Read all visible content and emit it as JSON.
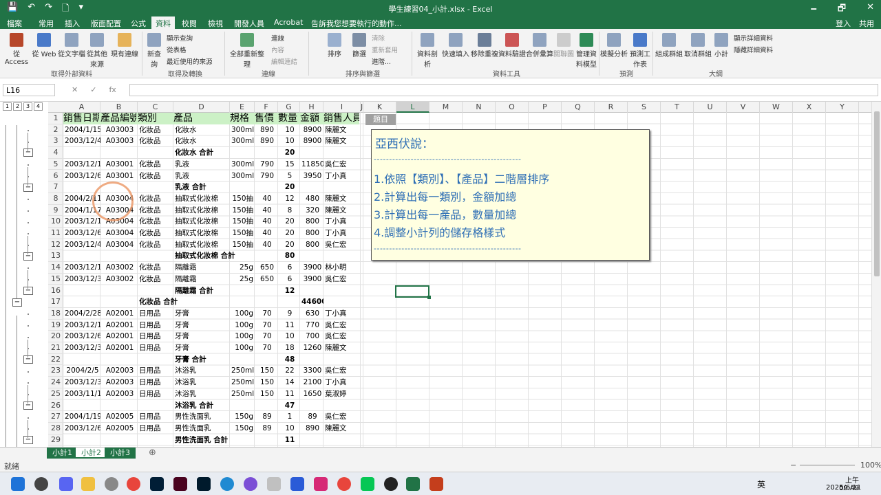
{
  "window": {
    "title": "學生練習04_小計.xlsx - Excel",
    "controls": [
      "🗕",
      "🗗",
      "✕"
    ],
    "quick_access": [
      "💾",
      "↶",
      "↷",
      "🗋",
      "▾"
    ]
  },
  "ribbon_tabs": [
    "檔案",
    "常用",
    "插入",
    "版面配置",
    "公式",
    "資料",
    "校閱",
    "檢視",
    "開發人員",
    "Acrobat",
    "告訴我您想要執行的動作..."
  ],
  "active_tab": "資料",
  "account": {
    "signin": "登入",
    "share": "共用"
  },
  "ribbon": {
    "groups": [
      "取得外部資料",
      "取得及轉換",
      "連線",
      "排序與篩選",
      "資料工具",
      "預測",
      "大綱"
    ],
    "buttons": {
      "access": "從 Access",
      "web": "從 Web",
      "text": "從文字檔",
      "other": "從其他來源",
      "existing": "現有連線",
      "newquery": "新查詢",
      "showquery": "顯示查詢",
      "fromtable": "從表格",
      "recent": "最近使用的來源",
      "refreshall": "全部重新整理",
      "conn": "連線",
      "props": "內容",
      "editlinks": "編輯連結",
      "sort": "排序",
      "filter": "篩選",
      "clear": "清除",
      "reapply": "重新套用",
      "advanced": "進階...",
      "textcol": "資料剖析",
      "flash": "快速填入",
      "dup": "移除重複",
      "valid": "資料驗證",
      "consol": "合併彙算",
      "rel": "關聯圖",
      "model": "管理資料模型",
      "whatif": "模擬分析",
      "forecast": "預測工作表",
      "group": "組成群組",
      "ungroup": "取消群組",
      "subtotal": "小計",
      "showdetail": "顯示詳細資料",
      "hidedetail": "隱藏詳細資料"
    }
  },
  "namebox": "L16",
  "fx": "fx",
  "columns": [
    "A",
    "B",
    "C",
    "D",
    "E",
    "F",
    "G",
    "H",
    "I",
    "J",
    "K",
    "L",
    "M",
    "N",
    "O",
    "P",
    "Q",
    "R",
    "S",
    "T",
    "U",
    "V",
    "W",
    "X",
    "Y"
  ],
  "selected_col": "L",
  "outline_levels": [
    "1",
    "2",
    "3",
    "4"
  ],
  "rows": [
    {
      "n": "1",
      "hdr": true,
      "A": "銷售日期",
      "B": "產品編號",
      "C": "類別",
      "D": "產品",
      "E": "規格",
      "F": "售價",
      "G": "數量",
      "H": "金額",
      "I": "銷售人員"
    },
    {
      "n": "2",
      "A": "2004/1/15",
      "B": "A03003",
      "C": "化妝品",
      "D": "化妝水",
      "E": "300ml",
      "F": "890",
      "G": "10",
      "H": "8900",
      "I": "陳麗文"
    },
    {
      "n": "3",
      "A": "2003/12/4",
      "B": "A03003",
      "C": "化妝品",
      "D": "化妝水",
      "E": "300ml",
      "F": "890",
      "G": "10",
      "H": "8900",
      "I": "陳麗文"
    },
    {
      "n": "4",
      "D": "化妝水 合計",
      "G": "20",
      "sub": true
    },
    {
      "n": "5",
      "A": "2003/12/16",
      "B": "A03001",
      "C": "化妝品",
      "D": "乳液",
      "E": "300ml",
      "F": "790",
      "G": "15",
      "H": "11850",
      "I": "吳仁宏"
    },
    {
      "n": "6",
      "A": "2003/12/6",
      "B": "A03001",
      "C": "化妝品",
      "D": "乳液",
      "E": "300ml",
      "F": "790",
      "G": "5",
      "H": "3950",
      "I": "丁小真"
    },
    {
      "n": "7",
      "D": "乳液 合計",
      "G": "20",
      "sub": true
    },
    {
      "n": "8",
      "A": "2004/2/11",
      "B": "A03004",
      "C": "化妝品",
      "D": "抽取式化妝棉",
      "E": "150抽",
      "F": "40",
      "G": "12",
      "H": "480",
      "I": "陳麗文"
    },
    {
      "n": "9",
      "A": "2004/1/17",
      "B": "A03004",
      "C": "化妝品",
      "D": "抽取式化妝棉",
      "E": "150抽",
      "F": "40",
      "G": "8",
      "H": "320",
      "I": "陳麗文"
    },
    {
      "n": "10",
      "A": "2003/12/10",
      "B": "A03004",
      "C": "化妝品",
      "D": "抽取式化妝棉",
      "E": "150抽",
      "F": "40",
      "G": "20",
      "H": "800",
      "I": "丁小真"
    },
    {
      "n": "11",
      "A": "2003/12/6",
      "B": "A03004",
      "C": "化妝品",
      "D": "抽取式化妝棉",
      "E": "150抽",
      "F": "40",
      "G": "20",
      "H": "800",
      "I": "丁小真"
    },
    {
      "n": "12",
      "A": "2003/12/4",
      "B": "A03004",
      "C": "化妝品",
      "D": "抽取式化妝棉",
      "E": "150抽",
      "F": "40",
      "G": "20",
      "H": "800",
      "I": "吳仁宏"
    },
    {
      "n": "13",
      "D": "抽取式化妝棉 合計",
      "G": "80",
      "sub": true
    },
    {
      "n": "14",
      "A": "2003/12/10",
      "B": "A03002",
      "C": "化妝品",
      "D": "隔離霜",
      "E": "25g",
      "F": "650",
      "G": "6",
      "H": "3900",
      "I": "林小明"
    },
    {
      "n": "15",
      "A": "2003/12/3",
      "B": "A03002",
      "C": "化妝品",
      "D": "隔離霜",
      "E": "25g",
      "F": "650",
      "G": "6",
      "H": "3900",
      "I": "吳仁宏"
    },
    {
      "n": "16",
      "D": "隔離霜 合計",
      "G": "12",
      "sub": true
    },
    {
      "n": "17",
      "C": "化妝品 合計",
      "H": "44600",
      "cat": true
    },
    {
      "n": "18",
      "A": "2004/2/28",
      "B": "A02001",
      "C": "日用品",
      "D": "牙膏",
      "E": "100g",
      "F": "70",
      "G": "9",
      "H": "630",
      "I": "丁小真"
    },
    {
      "n": "19",
      "A": "2003/12/15",
      "B": "A02001",
      "C": "日用品",
      "D": "牙膏",
      "E": "100g",
      "F": "70",
      "G": "11",
      "H": "770",
      "I": "吳仁宏"
    },
    {
      "n": "20",
      "A": "2003/12/6",
      "B": "A02001",
      "C": "日用品",
      "D": "牙膏",
      "E": "100g",
      "F": "70",
      "G": "10",
      "H": "700",
      "I": "吳仁宏"
    },
    {
      "n": "21",
      "A": "2003/12/3",
      "B": "A02001",
      "C": "日用品",
      "D": "牙膏",
      "E": "100g",
      "F": "70",
      "G": "18",
      "H": "1260",
      "I": "陳麗文"
    },
    {
      "n": "22",
      "D": "牙膏 合計",
      "G": "48",
      "sub": true
    },
    {
      "n": "23",
      "A": "2004/2/5",
      "B": "A02003",
      "C": "日用品",
      "D": "沐浴乳",
      "E": "250ml",
      "F": "150",
      "G": "22",
      "H": "3300",
      "I": "吳仁宏"
    },
    {
      "n": "24",
      "A": "2003/12/3",
      "B": "A02003",
      "C": "日用品",
      "D": "沐浴乳",
      "E": "250ml",
      "F": "150",
      "G": "14",
      "H": "2100",
      "I": "丁小真"
    },
    {
      "n": "25",
      "A": "2003/11/11",
      "B": "A02003",
      "C": "日用品",
      "D": "沐浴乳",
      "E": "250ml",
      "F": "150",
      "G": "11",
      "H": "1650",
      "I": "葉淑婷"
    },
    {
      "n": "26",
      "D": "沐浴乳 合計",
      "G": "47",
      "sub": true
    },
    {
      "n": "27",
      "A": "2004/1/19",
      "B": "A02005",
      "C": "日用品",
      "D": "男性洗面乳",
      "E": "150g",
      "F": "89",
      "G": "1",
      "H": "89",
      "I": "吳仁宏"
    },
    {
      "n": "28",
      "A": "2003/12/6",
      "B": "A02005",
      "C": "日用品",
      "D": "男性洗面乳",
      "E": "150g",
      "F": "89",
      "G": "10",
      "H": "890",
      "I": "陳麗文"
    },
    {
      "n": "29",
      "D": "男性洗面乳 合計",
      "G": "11",
      "sub": true
    }
  ],
  "comment_tag": "題目",
  "note": {
    "heading": "亞西伏說：",
    "dash": "------------------------------------------------",
    "lines": [
      "1.依照【類別】、【產品】二階層排序",
      "2.計算出每一類別，金額加總",
      "3.計算出每一產品，數量加總",
      "4.調整小計列的儲存格樣式"
    ]
  },
  "sheets": [
    "小計1",
    "小計2",
    "小計3"
  ],
  "active_sheet": "小計2",
  "status": {
    "ready": "就緒",
    "zoom": "100%"
  },
  "taskbar": {
    "time": "上午 09:49",
    "date": "2025/6/11",
    "ime": "英"
  }
}
